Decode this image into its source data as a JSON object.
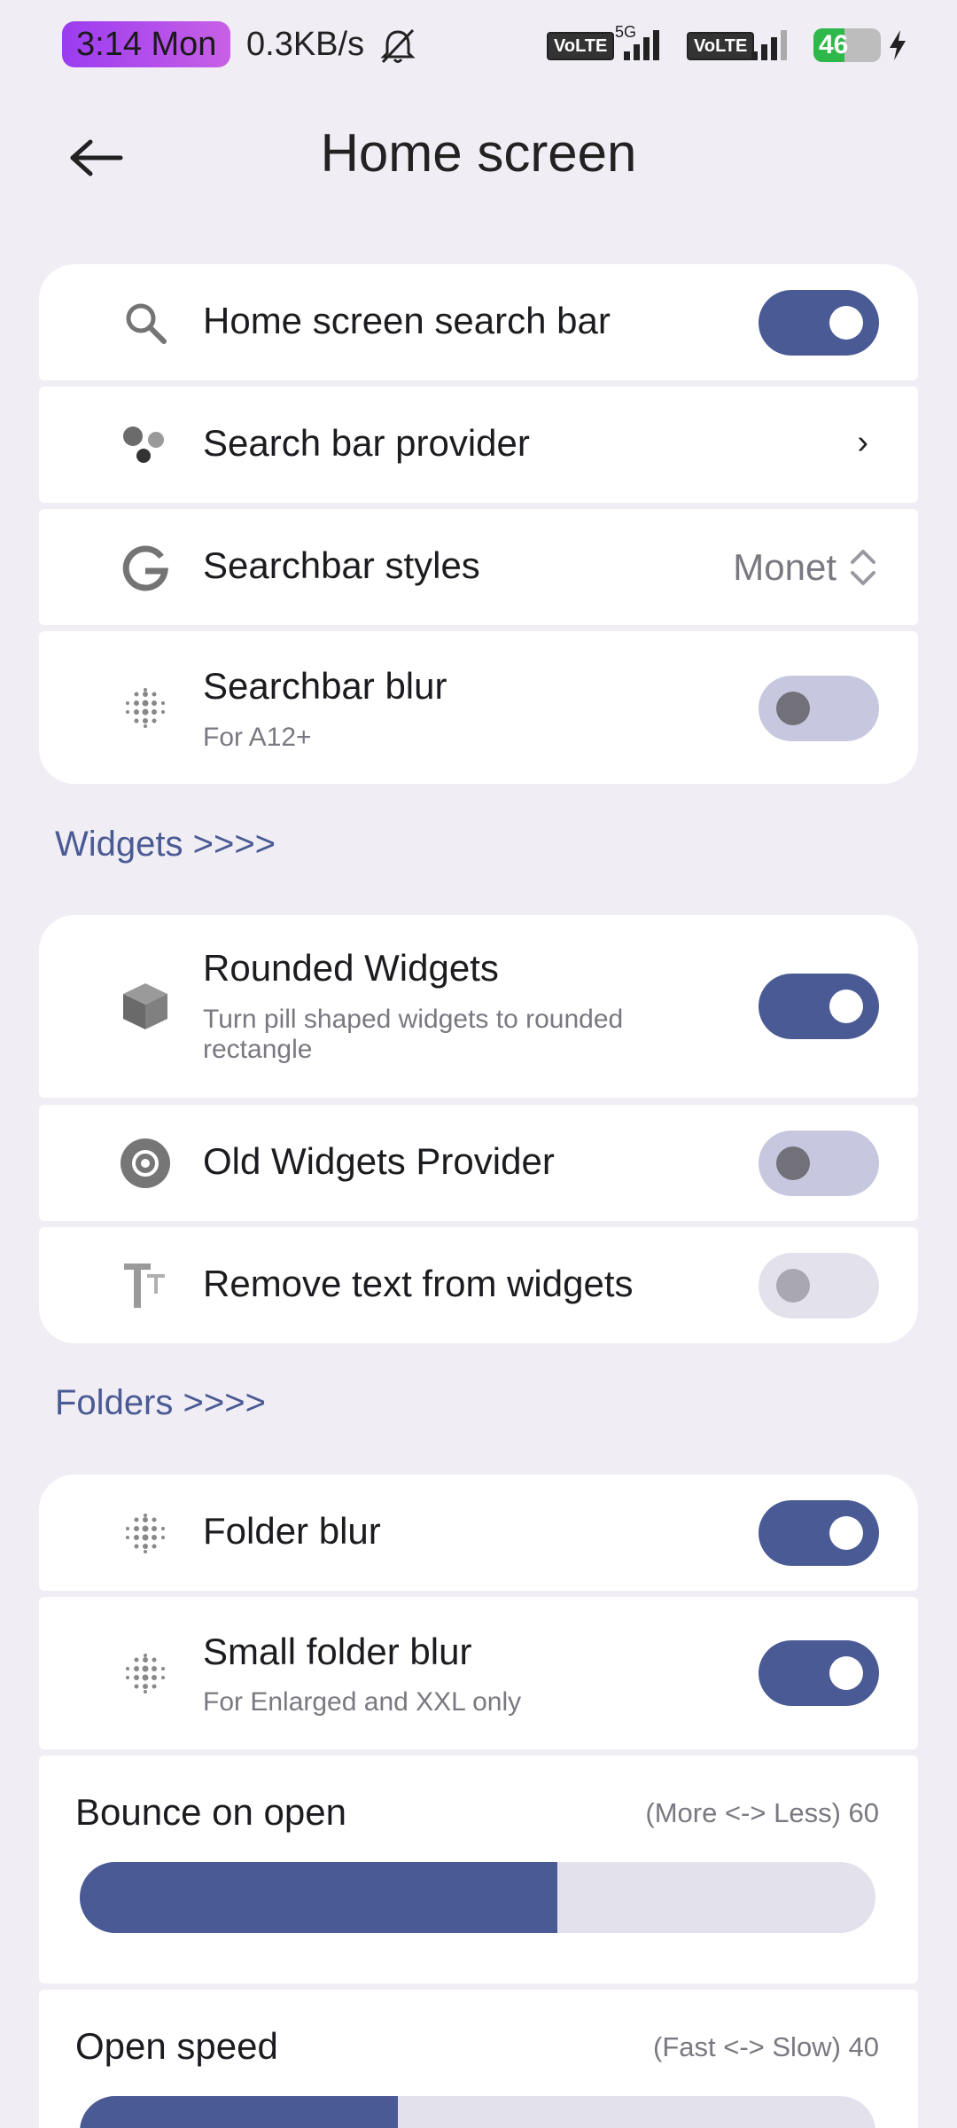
{
  "status_bar": {
    "time": "3:14 Mon",
    "net_speed": "0.3KB/s",
    "volte1": "VoLTE",
    "network": "5G",
    "volte2": "VoLTE",
    "battery": "46"
  },
  "header": {
    "title": "Home screen"
  },
  "search_section": {
    "items": [
      {
        "title": "Home screen search bar",
        "icon": "search-icon",
        "toggle": "on"
      },
      {
        "title": "Search bar provider",
        "icon": "assistant-dots-icon",
        "chevron": "›"
      },
      {
        "title": "Searchbar styles",
        "icon": "google-g-icon",
        "value": "Monet"
      },
      {
        "title": "Searchbar blur",
        "subtitle": "For A12+",
        "icon": "blur-icon",
        "toggle": "off"
      }
    ]
  },
  "widgets_section": {
    "header": "Widgets >>>>",
    "items": [
      {
        "title": "Rounded Widgets",
        "subtitle": "Turn pill shaped widgets to rounded rectangle",
        "icon": "cube-icon",
        "toggle": "on"
      },
      {
        "title": "Old Widgets Provider",
        "icon": "target-icon",
        "toggle": "off"
      },
      {
        "title": "Remove text from widgets",
        "icon": "text-size-icon",
        "toggle": "disabled"
      }
    ]
  },
  "folders_section": {
    "header": "Folders >>>>",
    "items": [
      {
        "title": "Folder blur",
        "icon": "blur-icon",
        "toggle": "on"
      },
      {
        "title": "Small folder blur",
        "subtitle": "For Enlarged and XXL only",
        "icon": "blur-icon",
        "toggle": "on"
      }
    ],
    "sliders": [
      {
        "label": "Bounce on open",
        "hint": "(More <-> Less) 60",
        "value": 60
      },
      {
        "label": "Open speed",
        "hint": "(Fast <-> Slow) 40",
        "value": 40
      }
    ]
  },
  "colors": {
    "accent": "#4a5a94",
    "background": "#f0eef4",
    "card": "#ffffff"
  }
}
